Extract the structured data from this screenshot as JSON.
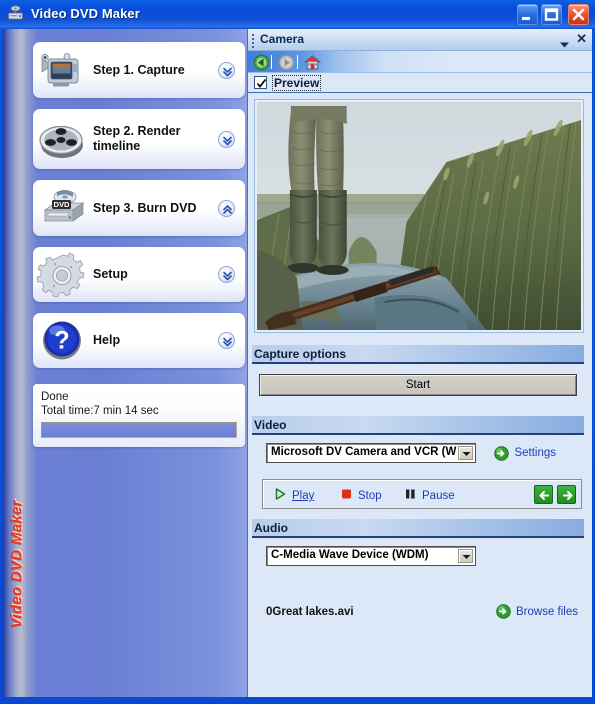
{
  "window": {
    "title": "Video DVD Maker",
    "app_icon": "dvd-burner-icon",
    "minimize_label": "Minimize",
    "maximize_label": "Maximize",
    "close_label": "Close"
  },
  "sidebar": {
    "brand_vertical": "Video DVD Maker",
    "steps": [
      {
        "label": "Step 1. Capture",
        "icon": "camcorder-icon",
        "chevron": "down"
      },
      {
        "label": "Step 2. Render timeline",
        "icon": "film-reel-icon",
        "chevron": "down"
      },
      {
        "label": "Step 3. Burn DVD",
        "icon": "dvd-drive-icon",
        "chevron": "up"
      },
      {
        "label": "Setup",
        "icon": "gear-icon",
        "chevron": "down"
      },
      {
        "label": "Help",
        "icon": "question-mark-icon",
        "chevron": "down"
      }
    ],
    "status": {
      "state": "Done",
      "total_time": "Total time:7 min 14 sec",
      "progress_percent": 100
    }
  },
  "panel": {
    "title": "Camera",
    "dropdown_icon": "chevron-down-icon",
    "close_icon": "close-icon",
    "toolbar": {
      "back": "back-icon",
      "forward": "forward-icon",
      "home": "home-icon"
    },
    "preview": {
      "label": "Preview",
      "checked": true
    },
    "video_preview": {
      "alt": "Hunter in waders standing on a boat among tall reeds in a marsh with a shotgun"
    },
    "capture_options": {
      "header": "Capture options",
      "start_label": "Start"
    },
    "video": {
      "header": "Video",
      "device": "Microsoft DV Camera and VCR (W",
      "settings_label": "Settings",
      "settings_icon": "green-arrow-circle-icon"
    },
    "transport": {
      "play": "Play",
      "stop": "Stop",
      "pause": "Pause",
      "play_icon": "play-triangle-icon",
      "stop_icon": "stop-square-icon",
      "pause_icon": "pause-bars-icon",
      "prev_icon": "arrow-left-icon",
      "next_icon": "arrow-right-icon"
    },
    "audio": {
      "header": "Audio",
      "device": "C-Media Wave Device (WDM)"
    },
    "file": {
      "name": "0Great lakes.avi",
      "browse_label": "Browse files",
      "browse_icon": "green-arrow-circle-icon"
    }
  },
  "colors": {
    "title_blue": "#0b55dd",
    "sidebar_blue": "#6a7fd3",
    "panel_bg": "#dce8f7",
    "link_blue": "#1a3fb5",
    "brand_red": "#f03a1e",
    "green": "#1f8c1f"
  }
}
